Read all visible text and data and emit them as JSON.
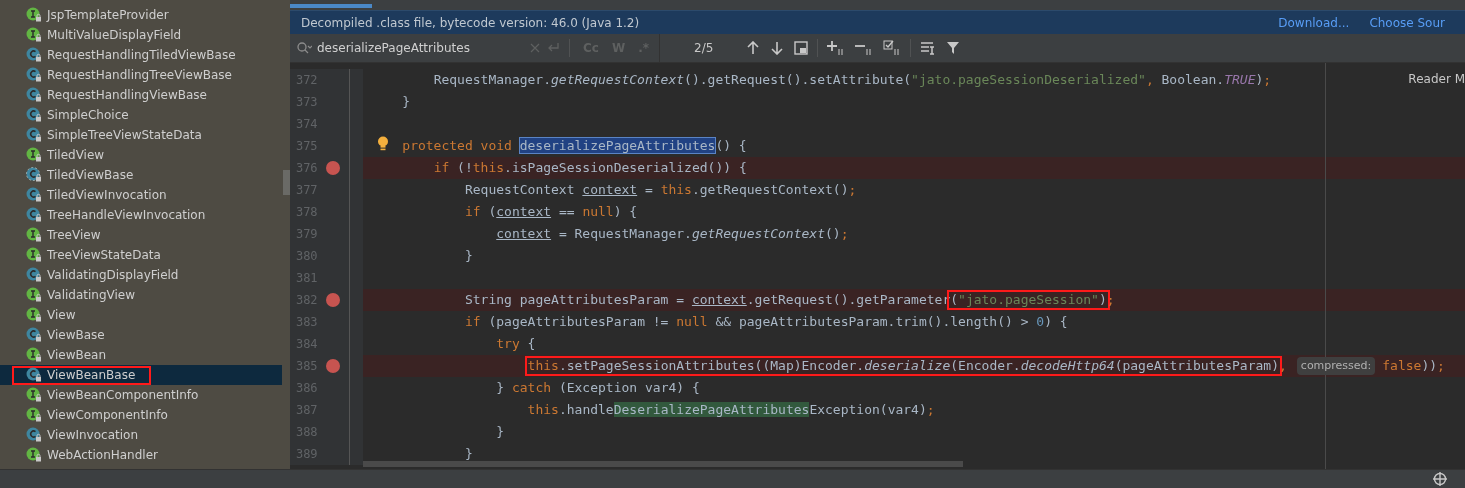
{
  "sidebar": {
    "items": [
      {
        "label": "JspTemplateProvider",
        "kind": "interface",
        "selected": false,
        "boxed": false
      },
      {
        "label": "MultiValueDisplayField",
        "kind": "interface",
        "selected": false,
        "boxed": false
      },
      {
        "label": "RequestHandlingTiledViewBase",
        "kind": "class",
        "selected": false,
        "boxed": false
      },
      {
        "label": "RequestHandlingTreeViewBase",
        "kind": "class",
        "selected": false,
        "boxed": false
      },
      {
        "label": "RequestHandlingViewBase",
        "kind": "class",
        "selected": false,
        "boxed": false
      },
      {
        "label": "SimpleChoice",
        "kind": "class",
        "selected": false,
        "boxed": false
      },
      {
        "label": "SimpleTreeViewStateData",
        "kind": "class",
        "selected": false,
        "boxed": false
      },
      {
        "label": "TiledView",
        "kind": "interface",
        "selected": false,
        "boxed": false
      },
      {
        "label": "TiledViewBase",
        "kind": "abstract",
        "selected": false,
        "boxed": false
      },
      {
        "label": "TiledViewInvocation",
        "kind": "class",
        "selected": false,
        "boxed": false
      },
      {
        "label": "TreeHandleViewInvocation",
        "kind": "class",
        "selected": false,
        "boxed": false
      },
      {
        "label": "TreeView",
        "kind": "interface",
        "selected": false,
        "boxed": false
      },
      {
        "label": "TreeViewStateData",
        "kind": "interface",
        "selected": false,
        "boxed": false
      },
      {
        "label": "ValidatingDisplayField",
        "kind": "class",
        "selected": false,
        "boxed": false
      },
      {
        "label": "ValidatingView",
        "kind": "interface",
        "selected": false,
        "boxed": false
      },
      {
        "label": "View",
        "kind": "interface",
        "selected": false,
        "boxed": false
      },
      {
        "label": "ViewBase",
        "kind": "class",
        "selected": false,
        "boxed": false
      },
      {
        "label": "ViewBean",
        "kind": "interface",
        "selected": false,
        "boxed": false
      },
      {
        "label": "ViewBeanBase",
        "kind": "class",
        "selected": true,
        "boxed": true
      },
      {
        "label": "ViewBeanComponentInfo",
        "kind": "interface",
        "selected": false,
        "boxed": false
      },
      {
        "label": "ViewComponentInfo",
        "kind": "interface",
        "selected": false,
        "boxed": false
      },
      {
        "label": "ViewInvocation",
        "kind": "class",
        "selected": false,
        "boxed": false
      },
      {
        "label": "WebActionHandler",
        "kind": "interface",
        "selected": false,
        "boxed": false
      }
    ]
  },
  "banner": {
    "message": "Decompiled .class file, bytecode version: 46.0 (Java 1.2)",
    "links": [
      "Download...",
      "Choose Sour"
    ]
  },
  "search": {
    "value": "deserializePageAttributes",
    "options": [
      "Cc",
      "W",
      ".*"
    ],
    "count": "2/5"
  },
  "side_note": "Reader M",
  "editor": {
    "lines": [
      {
        "number": "372",
        "breakpoint": false,
        "bulb": false,
        "segments": [
          {
            "kind": "text",
            "text": "        RequestManager."
          },
          {
            "kind": "static",
            "text": "getRequestContext"
          },
          {
            "kind": "text",
            "text": "().getRequest().setAttribute("
          },
          {
            "kind": "string",
            "text": "\"jato.pageSessionDeserialized\""
          },
          {
            "kind": "keyword",
            "text": ", "
          },
          {
            "kind": "text",
            "text": "Boolean."
          },
          {
            "kind": "constant",
            "text": "TRUE"
          },
          {
            "kind": "text",
            "text": ")"
          },
          {
            "kind": "keyword",
            "text": ";"
          }
        ]
      },
      {
        "number": "373",
        "breakpoint": false,
        "bulb": false,
        "segments": [
          {
            "kind": "text",
            "text": "    }"
          }
        ]
      },
      {
        "number": "374",
        "breakpoint": false,
        "bulb": false
      },
      {
        "number": "375",
        "breakpoint": false,
        "bulb": true,
        "segments": [
          {
            "kind": "keyword",
            "text": "    protected void "
          },
          {
            "kind": "current-match",
            "text": "deserializePageAttributes"
          },
          {
            "kind": "text",
            "text": "() {"
          }
        ]
      },
      {
        "number": "376",
        "breakpoint": true,
        "bulb": false,
        "segments": [
          {
            "kind": "keyword",
            "text": "        if "
          },
          {
            "kind": "text",
            "text": "(!"
          },
          {
            "kind": "keyword",
            "text": "this"
          },
          {
            "kind": "text",
            "text": ".isPageSessionDeserialized()) {"
          }
        ]
      },
      {
        "number": "377",
        "breakpoint": false,
        "bulb": false,
        "segments": [
          {
            "kind": "text",
            "text": "            RequestContext "
          },
          {
            "kind": "reassigned",
            "text": "context"
          },
          {
            "kind": "text",
            "text": " = "
          },
          {
            "kind": "keyword",
            "text": "this"
          },
          {
            "kind": "text",
            "text": ".getRequestContext()"
          },
          {
            "kind": "keyword",
            "text": ";"
          }
        ]
      },
      {
        "number": "378",
        "breakpoint": false,
        "bulb": false,
        "segments": [
          {
            "kind": "keyword",
            "text": "            if "
          },
          {
            "kind": "text",
            "text": "("
          },
          {
            "kind": "reassigned",
            "text": "context"
          },
          {
            "kind": "text",
            "text": " == "
          },
          {
            "kind": "keyword",
            "text": "null"
          },
          {
            "kind": "text",
            "text": ") {"
          }
        ]
      },
      {
        "number": "379",
        "breakpoint": false,
        "bulb": false,
        "segments": [
          {
            "kind": "reassigned",
            "text": "                context"
          },
          {
            "kind": "text",
            "text": " = RequestManager."
          },
          {
            "kind": "static",
            "text": "getRequestContext"
          },
          {
            "kind": "text",
            "text": "()"
          },
          {
            "kind": "keyword",
            "text": ";"
          }
        ]
      },
      {
        "number": "380",
        "breakpoint": false,
        "bulb": false,
        "segments": [
          {
            "kind": "text",
            "text": "            }"
          }
        ]
      },
      {
        "number": "381",
        "breakpoint": false,
        "bulb": false
      },
      {
        "number": "382",
        "breakpoint": true,
        "bulb": false,
        "segments": [
          {
            "kind": "text",
            "text": "            String pageAttributesParam = "
          },
          {
            "kind": "reassigned",
            "text": "context"
          },
          {
            "kind": "text",
            "text": ".getRequest().getParameter"
          },
          {
            "kind": "box",
            "tokens": [
              {
                "kind": "text",
                "text": "("
              },
              {
                "kind": "string",
                "text": "\"jato.pageSession\""
              },
              {
                "kind": "text",
                "text": ")"
              }
            ]
          },
          {
            "kind": "keyword",
            "text": ";"
          }
        ]
      },
      {
        "number": "383",
        "breakpoint": false,
        "bulb": false,
        "segments": [
          {
            "kind": "keyword",
            "text": "            if "
          },
          {
            "kind": "text",
            "text": "(pageAttributesParam != "
          },
          {
            "kind": "keyword",
            "text": "null"
          },
          {
            "kind": "text",
            "text": " && pageAttributesParam.trim().length() > "
          },
          {
            "kind": "number",
            "text": "0"
          },
          {
            "kind": "text",
            "text": ") {"
          }
        ]
      },
      {
        "number": "384",
        "breakpoint": false,
        "bulb": false,
        "segments": [
          {
            "kind": "keyword",
            "text": "                try "
          },
          {
            "kind": "text",
            "text": "{"
          }
        ]
      },
      {
        "number": "385",
        "breakpoint": true,
        "bulb": false,
        "segments": [
          {
            "kind": "box",
            "tokens": [
              {
                "kind": "keyword",
                "text": "                    this"
              },
              {
                "kind": "text",
                "text": ".setPageSessionAttributes((Map)Encoder."
              },
              {
                "kind": "static",
                "text": "deserialize"
              },
              {
                "kind": "text",
                "text": "(Encoder."
              },
              {
                "kind": "static",
                "text": "decodeHttp64"
              },
              {
                "kind": "text",
                "text": "(pageAttributesParam)"
              }
            ]
          },
          {
            "kind": "keyword",
            "text": ","
          },
          {
            "kind": "hint",
            "text": "compressed:"
          },
          {
            "kind": "keyword",
            "text": "false"
          },
          {
            "kind": "text",
            "text": "))"
          },
          {
            "kind": "keyword",
            "text": ";"
          }
        ]
      },
      {
        "number": "386",
        "breakpoint": false,
        "bulb": false,
        "segments": [
          {
            "kind": "text",
            "text": "                } "
          },
          {
            "kind": "keyword",
            "text": "catch "
          },
          {
            "kind": "text",
            "text": "(Exception var4) {"
          }
        ]
      },
      {
        "number": "387",
        "breakpoint": false,
        "bulb": false,
        "segments": [
          {
            "kind": "keyword",
            "text": "                    this"
          },
          {
            "kind": "text",
            "text": ".handle"
          },
          {
            "kind": "match",
            "text": "DeserializePageAttributes"
          },
          {
            "kind": "text",
            "text": "Exception(var4)"
          },
          {
            "kind": "keyword",
            "text": ";"
          }
        ]
      },
      {
        "number": "388",
        "breakpoint": false,
        "bulb": false,
        "segments": [
          {
            "kind": "text",
            "text": "                }"
          }
        ]
      },
      {
        "number": "389",
        "breakpoint": false,
        "bulb": false,
        "segments": [
          {
            "kind": "text",
            "text": "            }"
          }
        ]
      }
    ]
  }
}
